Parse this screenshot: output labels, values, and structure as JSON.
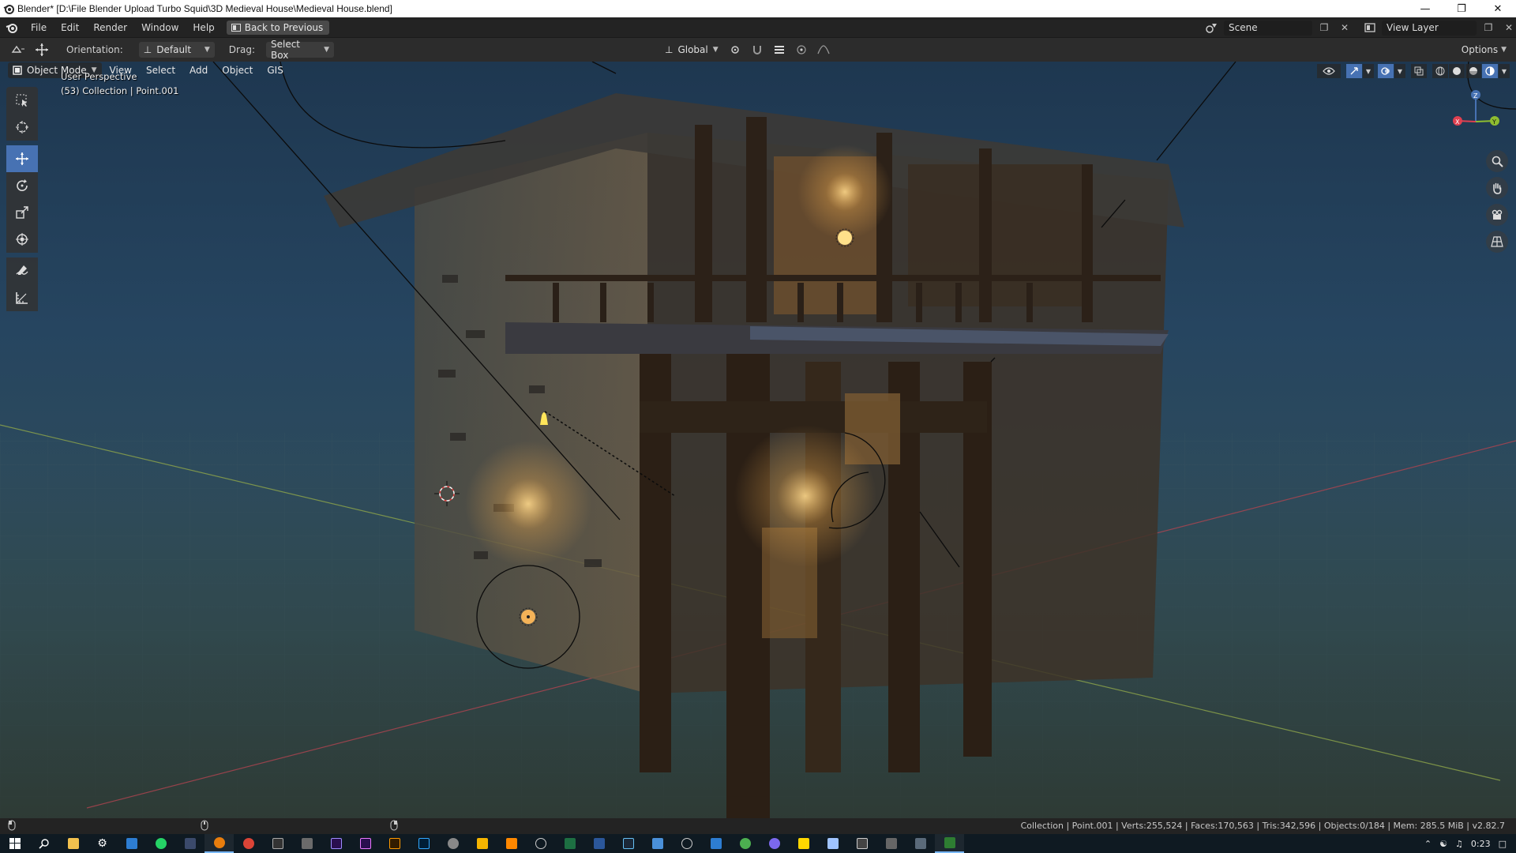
{
  "window": {
    "title": "Blender* [D:\\File Blender Upload Turbo Squid\\3D Medieval House\\Medieval House.blend]",
    "controls": [
      "minimize",
      "maximize",
      "close"
    ]
  },
  "menubar": {
    "items": [
      "File",
      "Edit",
      "Render",
      "Window",
      "Help"
    ],
    "back_button": "Back to Previous",
    "scene_name": "Scene",
    "view_layer": "View Layer"
  },
  "toolheader": {
    "orientation_label": "Orientation:",
    "orientation_value": "Default",
    "drag_label": "Drag:",
    "drag_value": "Select Box",
    "transform_orientation": "Global",
    "options_label": "Options"
  },
  "viewport": {
    "mode": "Object Mode",
    "menus": [
      "View",
      "Select",
      "Add",
      "Object",
      "GIS"
    ],
    "perspective_label": "User Perspective",
    "collection_label": "(53) Collection | Point.001",
    "gizmo_axes": {
      "x": "X",
      "y": "Y",
      "z": "Z"
    }
  },
  "tools": [
    {
      "name": "select-box",
      "icon": "select-box-icon",
      "active": false
    },
    {
      "name": "cursor",
      "icon": "cursor-icon",
      "active": false
    },
    {
      "name": "move",
      "icon": "move-icon",
      "active": true
    },
    {
      "name": "rotate",
      "icon": "rotate-icon",
      "active": false
    },
    {
      "name": "scale",
      "icon": "scale-icon",
      "active": false
    },
    {
      "name": "transform",
      "icon": "transform-icon",
      "active": false
    },
    {
      "name": "annotate",
      "icon": "annotate-icon",
      "active": false
    },
    {
      "name": "measure",
      "icon": "measure-icon",
      "active": false
    }
  ],
  "statusbar": {
    "info": "Collection | Point.001 | Verts:255,524 | Faces:170,563 | Tris:342,596 | Objects:0/184 | Mem: 285.5 MiB | v2.82.7"
  },
  "taskbar": {
    "clock": "0:23",
    "colors": {
      "accent": "#4772b3",
      "taskbar_bg": "#0f1a22"
    }
  }
}
